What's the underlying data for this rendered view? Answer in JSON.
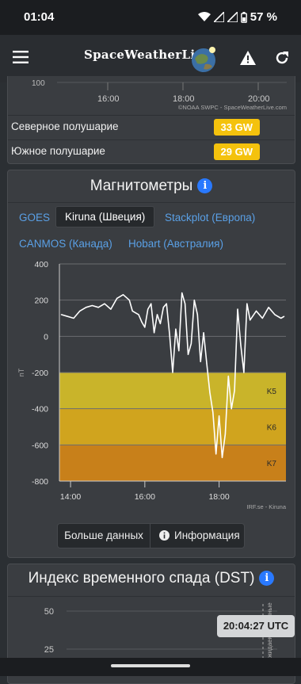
{
  "status_bar": {
    "time": "01:04",
    "battery": "57 %",
    "icons": [
      "wifi-icon",
      "signal-icon",
      "signal-icon",
      "battery-icon"
    ]
  },
  "app_bar": {
    "logo": "SpaceWeatherLive",
    "icons": [
      "menu-icon",
      "globe-logo-icon",
      "warning-icon",
      "refresh-icon"
    ]
  },
  "hemi_chart": {
    "y_tick": "100",
    "x_ticks": [
      "16:00",
      "18:00",
      "20:00"
    ],
    "credit": "©NOAA SWPC - SpaceWeatherLive.com"
  },
  "hemispheres": [
    {
      "label": "Северное полушарие",
      "value": "33 GW"
    },
    {
      "label": "Южное полушарие",
      "value": "29 GW"
    }
  ],
  "magnetometers": {
    "title": "Магнитометры",
    "info_glyph": "i",
    "tabs": [
      {
        "label": "GOES",
        "active": false
      },
      {
        "label": "Kiruna (Швеция)",
        "active": true
      },
      {
        "label": "Stackplot (Европа)",
        "active": false
      },
      {
        "label": "CANMOS (Канада)",
        "active": false
      },
      {
        "label": "Hobart (Австралия)",
        "active": false
      }
    ],
    "buttons": {
      "more": "Больше данных",
      "info": "Информация"
    }
  },
  "chart_data": {
    "type": "line",
    "title": "",
    "xlabel": "",
    "ylabel": "nT",
    "ylim": [
      -800,
      400
    ],
    "y_ticks": [
      "400",
      "200",
      "0",
      "-200",
      "-400",
      "-600",
      "-800"
    ],
    "x_ticks": [
      "14:00",
      "16:00",
      "18:00"
    ],
    "xlim_hours": [
      13.7,
      19.8
    ],
    "bands": [
      {
        "label": "K5",
        "from": -200,
        "to": -400,
        "color": "#c9b42a"
      },
      {
        "label": "K6",
        "from": -400,
        "to": -600,
        "color": "#d0a41e"
      },
      {
        "label": "K7",
        "from": -600,
        "to": -800,
        "color": "#c8801a"
      }
    ],
    "credit": "IRF.se - Kiruna",
    "series": [
      {
        "color": "#ffffff",
        "x": [
          "13:45",
          "13:55",
          "14:05",
          "14:15",
          "14:25",
          "14:35",
          "14:45",
          "14:55",
          "15:05",
          "15:15",
          "15:25",
          "15:35",
          "15:40",
          "15:50",
          "15:55",
          "16:00",
          "16:05",
          "16:10",
          "16:15",
          "16:20",
          "16:25",
          "16:30",
          "16:35",
          "16:40",
          "16:45",
          "16:50",
          "16:55",
          "17:00",
          "17:05",
          "17:10",
          "17:15",
          "17:20",
          "17:25",
          "17:30",
          "17:35",
          "17:40",
          "17:45",
          "17:50",
          "17:55",
          "18:00",
          "18:05",
          "18:10",
          "18:15",
          "18:20",
          "18:25",
          "18:30",
          "18:35",
          "18:40",
          "18:45",
          "18:50",
          "19:00",
          "19:10",
          "19:20",
          "19:30",
          "19:40",
          "19:45"
        ],
        "y": [
          120,
          110,
          100,
          140,
          160,
          170,
          160,
          180,
          150,
          210,
          230,
          200,
          140,
          120,
          80,
          50,
          150,
          180,
          20,
          120,
          70,
          160,
          180,
          10,
          -200,
          40,
          -80,
          240,
          180,
          -100,
          -40,
          200,
          120,
          -140,
          20,
          -150,
          -310,
          -420,
          -650,
          -440,
          -670,
          -540,
          -220,
          -400,
          -300,
          150,
          -50,
          -200,
          180,
          90,
          140,
          100,
          160,
          120,
          100,
          110
        ]
      }
    ]
  },
  "dst": {
    "title": "Индекс временного спада (DST)",
    "info_glyph": "i",
    "y_ticks": [
      "50",
      "25"
    ],
    "rotated_text": "Ожидаемые данные"
  },
  "time_badge": "20:04:27 UTC"
}
